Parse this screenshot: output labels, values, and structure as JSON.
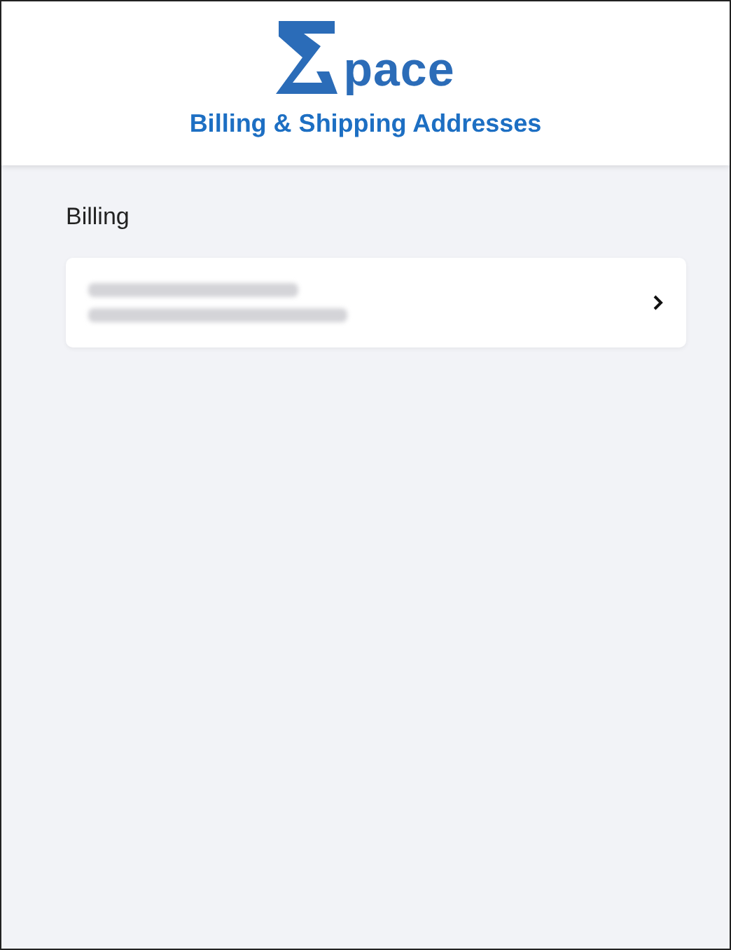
{
  "header": {
    "logo_text": "pace",
    "title": "Billing & Shipping Addresses"
  },
  "sections": [
    {
      "heading": "Billing",
      "addresses": [
        {
          "kind": "redacted"
        }
      ]
    }
  ]
}
